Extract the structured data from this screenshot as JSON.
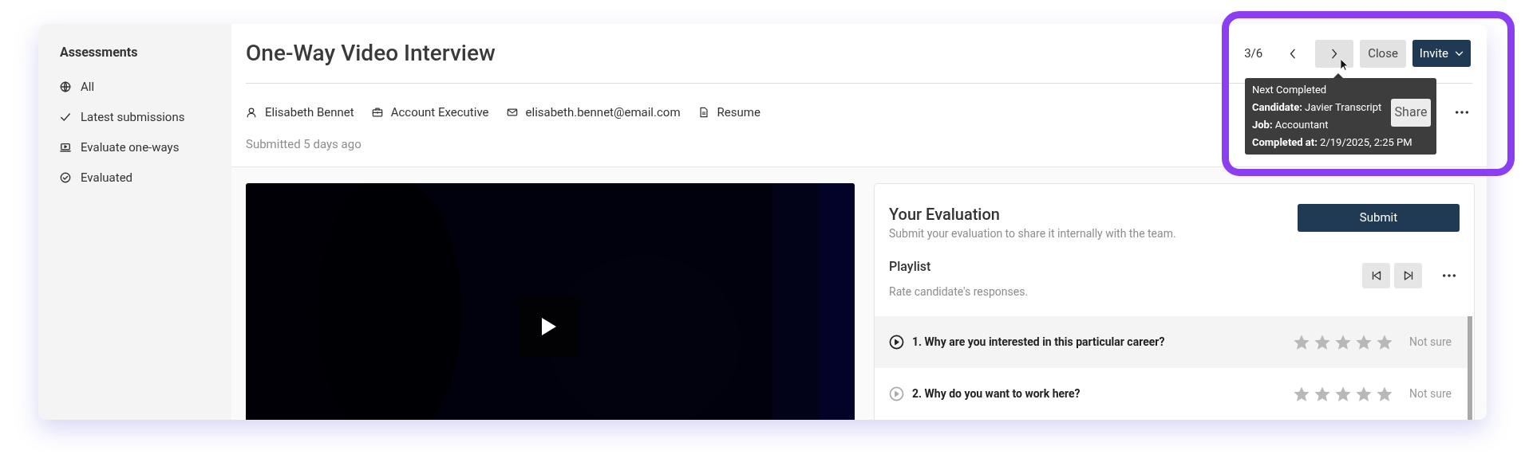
{
  "sidebar": {
    "title": "Assessments",
    "items": [
      {
        "label": "All"
      },
      {
        "label": "Latest submissions"
      },
      {
        "label": "Evaluate one-ways"
      },
      {
        "label": "Evaluated"
      }
    ]
  },
  "header": {
    "title": "One-Way Video Interview",
    "meta": [
      "Elisabeth Bennet",
      "Account Executive",
      "elisabeth.bennet@email.com",
      "Resume"
    ],
    "submitted": "Submitted 5 days ago"
  },
  "navigation": {
    "counter": "3/6",
    "close": "Close",
    "invite": "Invite",
    "share": "Share"
  },
  "tooltip": {
    "title": "Next Completed",
    "lines": [
      "**Candidate:** Javier Transcript",
      "**Job:** Accountant",
      "**Completed at:** 2/19/2025, 2:25 PM"
    ]
  },
  "evaluation": {
    "title": "Your Evaluation",
    "subtitle": "Submit your evaluation to share it internally with the team.",
    "submit": "Submit",
    "playlist_title": "Playlist",
    "playlist_subtitle": "Rate candidate's responses.",
    "questions": [
      {
        "text": "1. Why are you interested in this particular career?",
        "stars": 0,
        "rating": "Not sure",
        "selected": true
      },
      {
        "text": "2. Why do you want to work here?",
        "stars": 0,
        "rating": "Not sure",
        "selected": false
      }
    ]
  }
}
